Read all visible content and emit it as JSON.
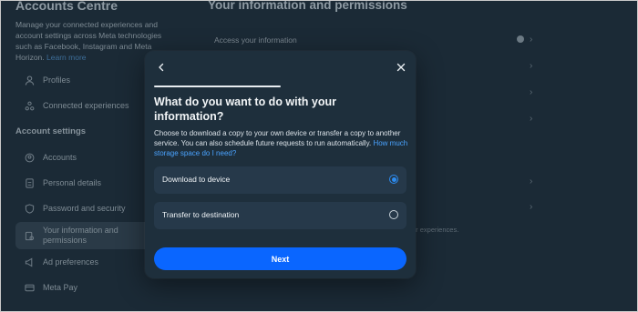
{
  "background": {
    "sidebar": {
      "title": "Accounts Centre",
      "description": "Manage your connected experiences and account settings across Meta technologies such as Facebook, Instagram and Meta Horizon.",
      "learn_more": "Learn more",
      "items_top": [
        {
          "label": "Profiles",
          "icon": "person-icon"
        },
        {
          "label": "Connected experiences",
          "icon": "connected-icon"
        }
      ],
      "section_label": "Account settings",
      "items_settings": [
        {
          "label": "Accounts",
          "icon": "accounts-icon"
        },
        {
          "label": "Personal details",
          "icon": "id-card-icon"
        },
        {
          "label": "Password and security",
          "icon": "shield-icon"
        },
        {
          "label": "Your information and permissions",
          "icon": "info-permissions-icon",
          "active": true
        },
        {
          "label": "Ad preferences",
          "icon": "megaphone-icon"
        },
        {
          "label": "Meta Pay",
          "icon": "card-icon"
        }
      ]
    },
    "main": {
      "title": "Your information and permissions",
      "first_row": "Access your information",
      "note_fragment": "ur experiences."
    }
  },
  "modal": {
    "title": "What do you want to do with your information?",
    "description": "Choose to download a copy to your own device or transfer a copy to another service. You can also schedule future requests to run automatically.",
    "help_link": "How much storage space do I need?",
    "options": [
      {
        "label": "Download to device",
        "selected": true
      },
      {
        "label": "Transfer to destination",
        "selected": false
      }
    ],
    "next_label": "Next"
  },
  "colors": {
    "accent": "#0a66ff",
    "link": "#4aa3ff",
    "modal_bg": "#1e2f3c",
    "page_bg": "#1b2a36"
  }
}
